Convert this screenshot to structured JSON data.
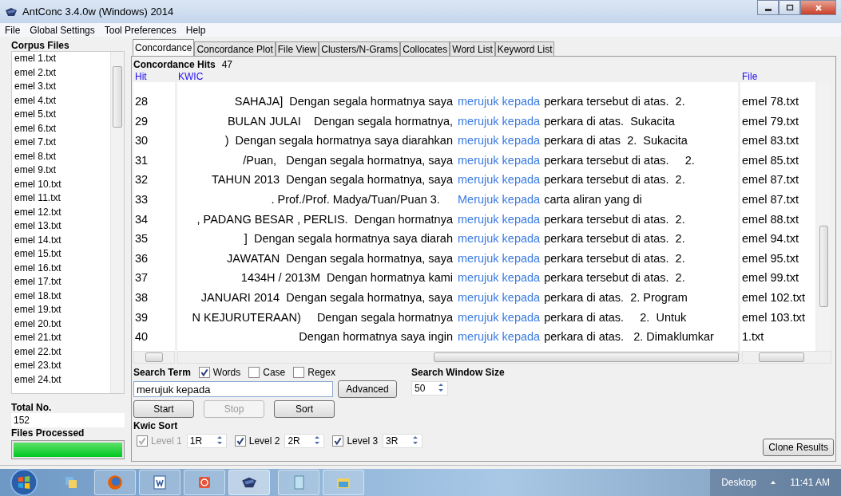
{
  "window": {
    "title": "AntConc 3.4.0w (Windows) 2014"
  },
  "menu": [
    "File",
    "Global Settings",
    "Tool Preferences",
    "Help"
  ],
  "corpus": {
    "title": "Corpus Files",
    "items": [
      "emel 1.txt",
      "emel 2.txt",
      "emel 3.txt",
      "emel 4.txt",
      "emel 5.txt",
      "emel 6.txt",
      "emel 7.txt",
      "emel 8.txt",
      "emel 9.txt",
      "emel 10.txt",
      "emel 11.txt",
      "emel 12.txt",
      "emel 13.txt",
      "emel 14.txt",
      "emel 15.txt",
      "emel 16.txt",
      "emel 17.txt",
      "emel 18.txt",
      "emel 19.txt",
      "emel 20.txt",
      "emel 21.txt",
      "emel 22.txt",
      "emel 23.txt",
      "emel 24.txt"
    ],
    "total_label": "Total No.",
    "total": "152",
    "processed_label": "Files Processed",
    "level": 1
  },
  "tabs": [
    {
      "label": "Concordance",
      "selected": true
    },
    {
      "label": "Concordance Plot",
      "selected": false
    },
    {
      "label": "File View",
      "selected": false
    },
    {
      "label": "Clusters/N-Grams",
      "selected": false
    },
    {
      "label": "Collocates",
      "selected": false
    },
    {
      "label": "Word List",
      "selected": false
    },
    {
      "label": "Keyword List",
      "selected": false
    }
  ],
  "hits_label": "Concordance Hits",
  "hits": "47",
  "columns": {
    "hit": "Hit",
    "kwic": "KWIC",
    "file": "File"
  },
  "rows": [
    {
      "hit": "28",
      "left": "SAHAJA]  Dengan segala hormatnya saya",
      "keyword": "merujuk kepada",
      "right": "perkara tersebut di atas.  2.",
      "file": "emel 78.txt"
    },
    {
      "hit": "29",
      "left": "BULAN JULAI    Dengan segala hormatnya,",
      "keyword": "merujuk kepada",
      "right": "perkara di atas.  Sukacita",
      "file": "emel 79.txt"
    },
    {
      "hit": "30",
      "left": ")  Dengan segala hormatnya saya diarahkan",
      "keyword": "merujuk kepada",
      "right": "perkara di atas  2.  Sukacita",
      "file": "emel 83.txt"
    },
    {
      "hit": "31",
      "left": "/Puan,   Dengan segala hormatnya, saya",
      "keyword": "merujuk kepada",
      "right": "perkara tersebut di atas.     2.",
      "file": "emel 85.txt"
    },
    {
      "hit": "32",
      "left": "TAHUN 2013  Dengan segala hormatnya, saya",
      "keyword": "merujuk kepada",
      "right": "perkara tersebut di atas.  2.",
      "file": "emel 87.txt"
    },
    {
      "hit": "33",
      "left": ". Prof./Prof. Madya/Tuan/Puan 3.    ",
      "keyword": "Merujuk kepada",
      "right": "carta aliran yang di",
      "file": "emel 87.txt"
    },
    {
      "hit": "34",
      "left": ", PADANG BESAR , PERLIS.  Dengan hormatnya",
      "keyword": "merujuk kepada",
      "right": "perkara tersebut di atas.  2.",
      "file": "emel 88.txt"
    },
    {
      "hit": "35",
      "left": "]  Dengan segala hormatnya saya diarah",
      "keyword": "merujuk kepada",
      "right": "perkara tersebut di atas.  2.",
      "file": "emel 94.txt"
    },
    {
      "hit": "36",
      "left": "JAWATAN  Dengan segala hormatnya, saya",
      "keyword": "merujuk kepada",
      "right": "perkara tersebut di atas.  2.",
      "file": "emel 95.txt"
    },
    {
      "hit": "37",
      "left": "1434H / 2013M  Dengan hormatnya kami",
      "keyword": "merujuk kepada",
      "right": "perkara tersebut di atas.  2.",
      "file": "emel 99.txt"
    },
    {
      "hit": "38",
      "left": "JANUARI 2014  Dengan segala hormatnya, saya",
      "keyword": "merujuk kepada",
      "right": "perkara di atas.  2. Program",
      "file": "emel 102.txt"
    },
    {
      "hit": "39",
      "left": "N KEJURUTERAAN)     Dengan segala hormatnya",
      "keyword": "merujuk kepada",
      "right": "perkara di atas.     2.  Untuk",
      "file": "emel 103.txt"
    },
    {
      "hit": "40",
      "left": "Dengan hormatnya saya ingin",
      "keyword": "merujuk kepada",
      "right": "perkara di atas.   2. Dimaklumkar",
      "file": "1.txt"
    }
  ],
  "search": {
    "label": "Search Term",
    "options": [
      {
        "label": "Words",
        "checked": true
      },
      {
        "label": "Case",
        "checked": false
      },
      {
        "label": "Regex",
        "checked": false
      }
    ],
    "value": "merujuk kepada",
    "advanced": "Advanced",
    "buttons": [
      {
        "label": "Start",
        "disabled": false
      },
      {
        "label": "Stop",
        "disabled": true
      },
      {
        "label": "Sort",
        "disabled": false
      }
    ],
    "window_label": "Search Window Size",
    "window_size": "50"
  },
  "kwic_sort": {
    "label": "Kwic Sort",
    "levels": [
      {
        "label": "Level 1",
        "value": "1R",
        "checked": true,
        "disabled": true
      },
      {
        "label": "Level 2",
        "value": "2R",
        "checked": true,
        "disabled": false
      },
      {
        "label": "Level 3",
        "value": "3R",
        "checked": true,
        "disabled": false
      }
    ]
  },
  "clone": "Clone Results",
  "taskbar": {
    "desktop": "Desktop",
    "clock": "11:41 AM"
  }
}
